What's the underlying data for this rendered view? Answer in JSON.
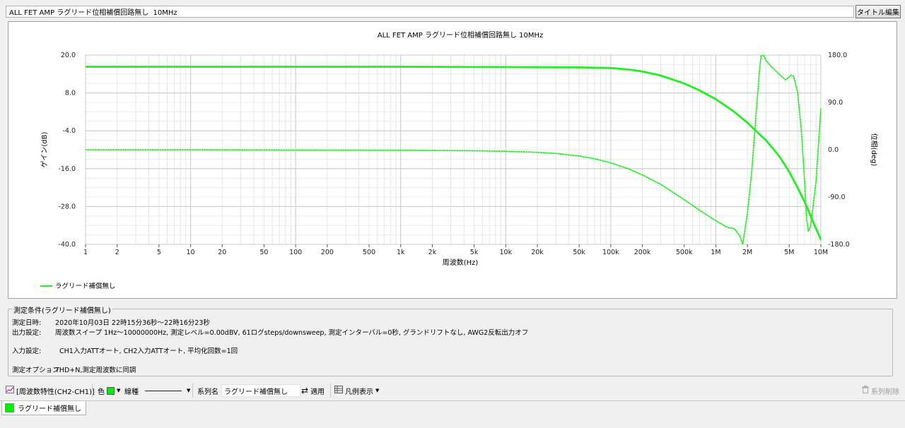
{
  "title_bar": {
    "title_value": "ALL FET AMP ラグリード位相補償回路無し  10MHz",
    "edit_button": "タイトル編集"
  },
  "chart_data": {
    "type": "line",
    "title": "ALL FET AMP ラグリード位相補償回路無し  10MHz",
    "xlabel": "周波数(Hz)",
    "ylabel_left": "ゲイン(dB)",
    "ylabel_right": "位相(deg)",
    "xscale": "log",
    "xlim": [
      1,
      10000000
    ],
    "ylim_left": [
      -40,
      20
    ],
    "ylim_right": [
      -180,
      180
    ],
    "x_ticks": [
      {
        "v": 1,
        "t": "1"
      },
      {
        "v": 2,
        "t": "2"
      },
      {
        "v": 5,
        "t": "5"
      },
      {
        "v": 10,
        "t": "10"
      },
      {
        "v": 20,
        "t": "20"
      },
      {
        "v": 50,
        "t": "50"
      },
      {
        "v": 100,
        "t": "100"
      },
      {
        "v": 200,
        "t": "200"
      },
      {
        "v": 500,
        "t": "500"
      },
      {
        "v": 1000,
        "t": "1k"
      },
      {
        "v": 2000,
        "t": "2k"
      },
      {
        "v": 5000,
        "t": "5k"
      },
      {
        "v": 10000,
        "t": "10k"
      },
      {
        "v": 20000,
        "t": "20k"
      },
      {
        "v": 50000,
        "t": "50k"
      },
      {
        "v": 100000,
        "t": "100k"
      },
      {
        "v": 200000,
        "t": "200k"
      },
      {
        "v": 500000,
        "t": "500k"
      },
      {
        "v": 1000000,
        "t": "1M"
      },
      {
        "v": 2000000,
        "t": "2M"
      },
      {
        "v": 5000000,
        "t": "5M"
      },
      {
        "v": 10000000,
        "t": "10M"
      }
    ],
    "y_ticks_left": [
      {
        "v": 20,
        "t": "20.0"
      },
      {
        "v": 8,
        "t": "8.0"
      },
      {
        "v": -4,
        "t": "-4.0"
      },
      {
        "v": -16,
        "t": "-16.0"
      },
      {
        "v": -28,
        "t": "-28.0"
      },
      {
        "v": -40,
        "t": "-40.0"
      }
    ],
    "y_ticks_right": [
      {
        "v": 180,
        "t": "180.0"
      },
      {
        "v": 90,
        "t": "90.0"
      },
      {
        "v": 0,
        "t": "0.0"
      },
      {
        "v": -90,
        "t": "-90.0"
      },
      {
        "v": -180,
        "t": "-180.0"
      }
    ],
    "grid": true,
    "series": [
      {
        "name": "ラグリード補償無し",
        "kind": "gain",
        "axis": "left",
        "style": "solid",
        "color": "#22ee22",
        "points": [
          [
            1,
            16.3
          ],
          [
            100,
            16.3
          ],
          [
            1000,
            16.3
          ],
          [
            10000,
            16.2
          ],
          [
            50000,
            16.1
          ],
          [
            100000,
            15.9
          ],
          [
            150000,
            15.4
          ],
          [
            200000,
            14.8
          ],
          [
            300000,
            13.5
          ],
          [
            500000,
            11.0
          ],
          [
            700000,
            8.8
          ],
          [
            1000000,
            6.0
          ],
          [
            1500000,
            2.0
          ],
          [
            2000000,
            -1.5
          ],
          [
            3000000,
            -7.0
          ],
          [
            4000000,
            -12.0
          ],
          [
            5000000,
            -17.0
          ],
          [
            6000000,
            -22.0
          ],
          [
            7000000,
            -26.5
          ],
          [
            8000000,
            -31.0
          ],
          [
            9000000,
            -35.0
          ],
          [
            10000000,
            -38.5
          ]
        ]
      },
      {
        "name": "ラグリード補償無し",
        "kind": "phase",
        "axis": "right",
        "style": "dotted",
        "color": "#22ee22",
        "points": [
          [
            1,
            0
          ],
          [
            10,
            0
          ],
          [
            100,
            -0.5
          ],
          [
            1000,
            -1
          ],
          [
            5000,
            -2
          ],
          [
            10000,
            -3
          ],
          [
            20000,
            -5
          ],
          [
            30000,
            -7
          ],
          [
            50000,
            -12
          ],
          [
            70000,
            -17
          ],
          [
            100000,
            -25
          ],
          [
            150000,
            -37
          ],
          [
            200000,
            -48
          ],
          [
            300000,
            -66
          ],
          [
            500000,
            -95
          ],
          [
            700000,
            -115
          ],
          [
            1000000,
            -135
          ],
          [
            1300000,
            -148
          ],
          [
            1500000,
            -150
          ],
          [
            1700000,
            -165
          ],
          [
            1800000,
            -180
          ],
          [
            1900000,
            -150
          ],
          [
            2000000,
            -120
          ],
          [
            2200000,
            -40
          ],
          [
            2400000,
            60
          ],
          [
            2600000,
            150
          ],
          [
            2700000,
            180
          ],
          [
            2850000,
            180
          ],
          [
            3000000,
            170
          ],
          [
            3300000,
            160
          ],
          [
            3700000,
            150
          ],
          [
            4200000,
            140
          ],
          [
            4600000,
            133
          ],
          [
            4900000,
            137
          ],
          [
            5200000,
            142
          ],
          [
            5500000,
            140
          ],
          [
            6000000,
            110
          ],
          [
            6500000,
            40
          ],
          [
            7000000,
            -60
          ],
          [
            7300000,
            -130
          ],
          [
            7600000,
            -155
          ],
          [
            8000000,
            -145
          ],
          [
            9000000,
            -60
          ],
          [
            10000000,
            80
          ]
        ]
      }
    ]
  },
  "legend": {
    "label": "ラグリード補償無し",
    "position": "bottom-left"
  },
  "conditions": {
    "title": "測定条件(ラグリード補償無し)",
    "datetime_label": "測定日時:",
    "datetime_value": "2020年10月03日  22時15分36秒〜22時16分23秒",
    "output_label": "出力設定:",
    "output_value": "周波数スイープ  1Hz〜10000000Hz, 測定レベル=0.00dBV, 61ログsteps/downsweep, 測定インターバル=0秒, グランドリフトなし, AWG2反転出力オフ",
    "input_label": "入力設定:",
    "input_value": "CH1入力ATTオート, CH2入力ATTオート, 平均化回数=1回",
    "option_label": "測定オプション:",
    "option_value": "THD+N,測定周波数に同調"
  },
  "toolbar": {
    "graph_type": "[周波数特性(CH2-CH1)]",
    "color_label": "色",
    "color_value": "#00ee00",
    "linetype_label": "線種",
    "series_name_label": "系列名",
    "series_name_value": "ラグリード補償無し",
    "apply_label": "適用",
    "legend_label": "凡例表示",
    "delete_label": "系列削除"
  },
  "tabs": [
    {
      "label": "ラグリード補償無し",
      "color": "#00ee00"
    }
  ]
}
